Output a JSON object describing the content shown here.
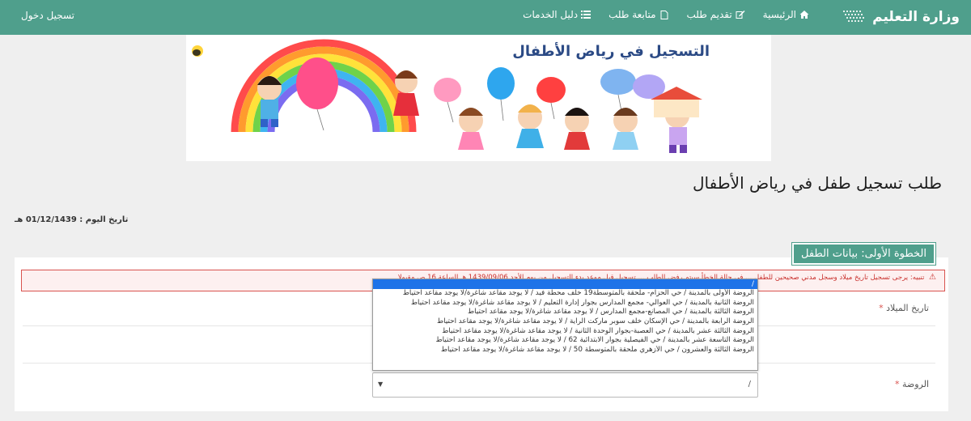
{
  "navbar": {
    "brand_name": "وزارة التعليم",
    "items": [
      {
        "label": "الرئيسية",
        "icon": "home-icon"
      },
      {
        "label": "تقديم طلب",
        "icon": "edit-icon"
      },
      {
        "label": "متابعة طلب",
        "icon": "document-icon"
      },
      {
        "label": "دليل الخدمات",
        "icon": "list-icon"
      }
    ],
    "login_label": "تسجيل دخول",
    "bg_color": "#4f9f8c"
  },
  "banner": {
    "title": "التسجيل في رياض الأطفال"
  },
  "page": {
    "title": "طلب تسجيل طفل في رياض الأطفال",
    "today_label": "تاريخ اليوم : 01/12/1439 هـ"
  },
  "form": {
    "step_title": "الخطوة الأولى: بيانات الطفل",
    "alert_text": "تنبيه: يرجى تسجيل تاريخ ميلاد وسجل مدني صحيحين للطفل ... في حالة الخطأ سيتم رفض الطلب ... تسجيل قبل موعد بدء التسجيل من يوم الأحد 1439/09/06 هـ الساعة 16 ص مقبولا",
    "birthdate_label": "تاريخ الميلاد",
    "kindergarten_label": "الروضة",
    "required_mark": "*",
    "select": {
      "value": "/",
      "options": [
        "/",
        "الروضة الأولى بالمدينة / حي الحزام- ملحقة بالمتوسطة19 خلف محطة فيد / لا يوجد مقاعد شاغرة/لا يوجد مقاعد احتياط",
        "الروضة الثانية بالمدينة / حي العوالي- مجمع المدارس بجوار إدارة التعليم / لا يوجد مقاعد شاغرة/لا يوجد مقاعد احتياط",
        "الروضة الثالثة بالمدينة / حي المصانع-مجمع المدارس / لا يوجد مقاعد شاغرة/لا يوجد مقاعد احتياط",
        "الروضة الرابعة بالمدينة / حي الإسكان خلف سوبر ماركت الراية / لا يوجد مقاعد شاغرة/لا يوجد مقاعد احتياط",
        "الروضة الثالثة عشر بالمدينة / حي العصبة-بجوار الوحدة الثانية / لا يوجد مقاعد شاغرة/لا يوجد مقاعد احتياط",
        "الروضة التاسعة عشر بالمدينة / حي الفيصلية بجوار الابتدائية 62 / لا يوجد مقاعد شاغرة/لا يوجد مقاعد احتياط",
        "الروضة الثالثة والعشرون / حي الأزهري ملحقة بالمتوسطة 50 / لا يوجد مقاعد شاغرة/لا يوجد مقاعد احتياط"
      ],
      "selected_index": 0
    }
  }
}
